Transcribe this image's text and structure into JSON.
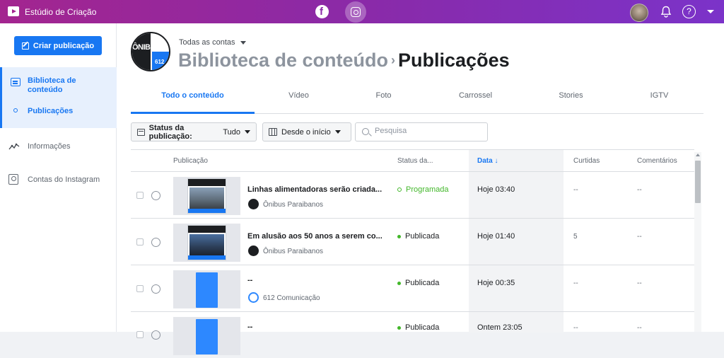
{
  "app": {
    "title": "Estúdio de Criação"
  },
  "topbar": {
    "facebook_icon": "facebook-icon",
    "instagram_icon": "instagram-icon",
    "help_label": "?"
  },
  "sidebar": {
    "create_button": "Criar publicação",
    "items": [
      {
        "label": "Biblioteca de conteúdo",
        "icon": "library-icon",
        "active": true
      },
      {
        "label": "Publicações",
        "icon": "dot-icon",
        "active": true
      },
      {
        "label": "Informações",
        "icon": "insights-icon"
      },
      {
        "label": "Contas do Instagram",
        "icon": "account-icon"
      }
    ]
  },
  "header": {
    "account_selector": "Todas as contas",
    "account_logo_text": "ÔNIBUS",
    "account_logo_number": "612",
    "breadcrumb_parent": "Biblioteca de conteúdo",
    "breadcrumb_separator": "›",
    "breadcrumb_current": "Publicações"
  },
  "tabs": [
    "Todo o conteúdo",
    "Vídeo",
    "Foto",
    "Carrossel",
    "Stories",
    "IGTV"
  ],
  "filters": {
    "status_label": "Status da publicação:",
    "status_value": "Tudo",
    "date_label": "Desde o início",
    "search_placeholder": "Pesquisa"
  },
  "table": {
    "headers": [
      "Publicação",
      "Status da...",
      "Data ↓",
      "Curtidas",
      "Comentários"
    ],
    "rows": [
      {
        "title": "Linhas alimentadoras serão criada...",
        "source": "Ônibus Paraibanos",
        "status": "Programada",
        "date": "Hoje 03:40",
        "likes": "--",
        "comments": "--"
      },
      {
        "title": "Em alusão aos 50 anos a serem co...",
        "source": "Ônibus Paraibanos",
        "status": "Publicada",
        "date": "Hoje 01:40",
        "likes": "5",
        "comments": "--"
      },
      {
        "title": "--",
        "source": "612 Comunicação",
        "status": "Publicada",
        "date": "Hoje 00:35",
        "likes": "--",
        "comments": "--"
      },
      {
        "title": "--",
        "source": "",
        "status": "Publicada",
        "date": "Ontem 23:05",
        "likes": "--",
        "comments": "--"
      }
    ]
  },
  "colors": {
    "accent": "#1877f2",
    "topbar_start": "#a3258f",
    "topbar_end": "#7b33c9",
    "published": "#42b72a"
  }
}
